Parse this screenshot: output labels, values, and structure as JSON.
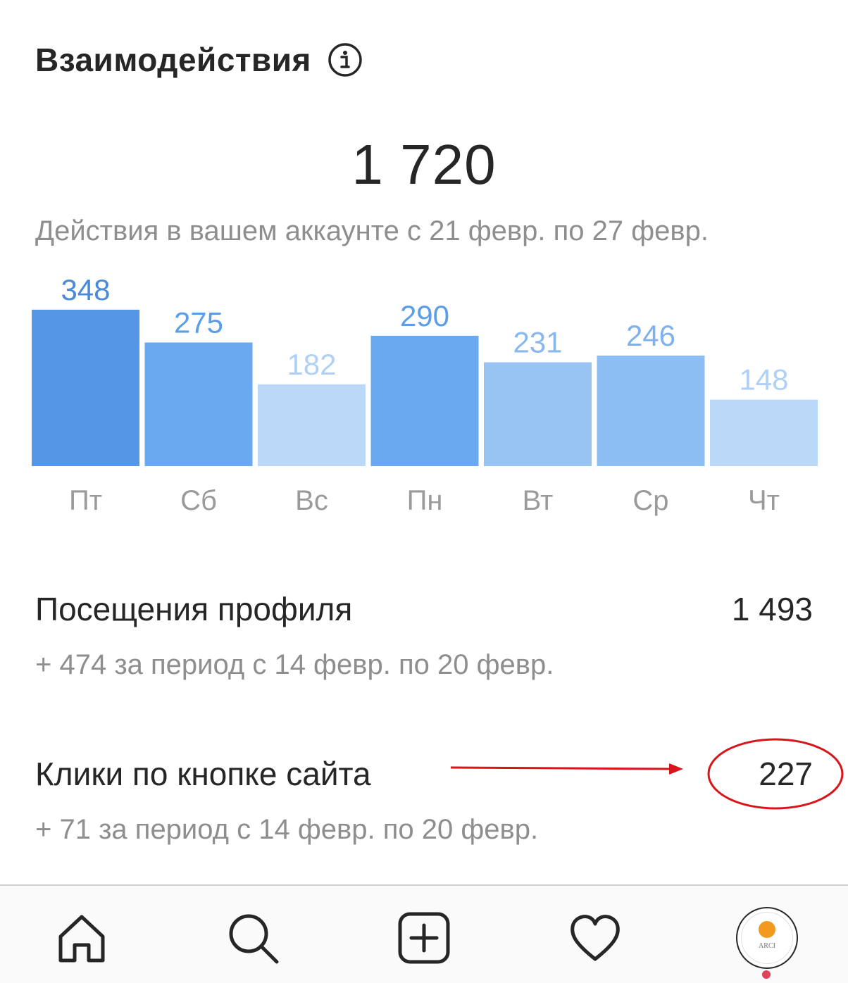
{
  "header": {
    "title": "Взаимодействия"
  },
  "summary": {
    "total": "1 720",
    "description": "Действия в вашем аккаунте с 21 февр. по 27 февр."
  },
  "chart_data": {
    "type": "bar",
    "categories": [
      "Пт",
      "Сб",
      "Вс",
      "Пн",
      "Вт",
      "Ср",
      "Чт"
    ],
    "values": [
      348,
      275,
      182,
      290,
      231,
      246,
      148
    ],
    "bar_colors": [
      "#5596e6",
      "#6aa9f0",
      "#bcd8f8",
      "#6aa9f0",
      "#98c4f4",
      "#8cbdf3",
      "#bcd8f8"
    ],
    "label_colors": [
      "#4a8ad6",
      "#5b9ee8",
      "#b0d0f5",
      "#5b9ee8",
      "#88b8ee",
      "#7fb2ec",
      "#b0d0f5"
    ]
  },
  "stats": [
    {
      "label": "Посещения профиля",
      "value": "1 493",
      "change": "+ 474 за период с 14 февр. по 20 февр."
    },
    {
      "label": "Клики по кнопке сайта",
      "value": "227",
      "change": "+ 71 за период с 14 февр. по 20 февр."
    }
  ],
  "annotation": {
    "color": "#d9141b"
  },
  "tabbar": {
    "items": [
      "home-icon",
      "search-icon",
      "add-post-icon",
      "heart-icon",
      "profile-avatar"
    ],
    "avatar_text": "ARCI"
  }
}
